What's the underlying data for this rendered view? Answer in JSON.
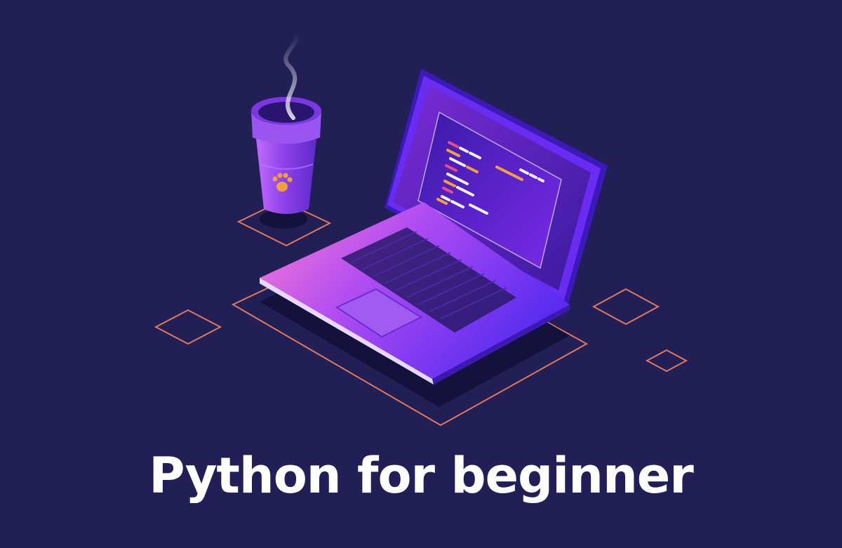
{
  "title": "Python for beginner",
  "colors": {
    "background": "#221f57",
    "outline": "#e07a5f",
    "accent_purple": "#8b3dff",
    "code_pink": "#e84c8b",
    "code_orange": "#f0a040",
    "code_white": "#f1f1f1"
  },
  "icons": {
    "cup_logo": "paw-print-icon"
  }
}
